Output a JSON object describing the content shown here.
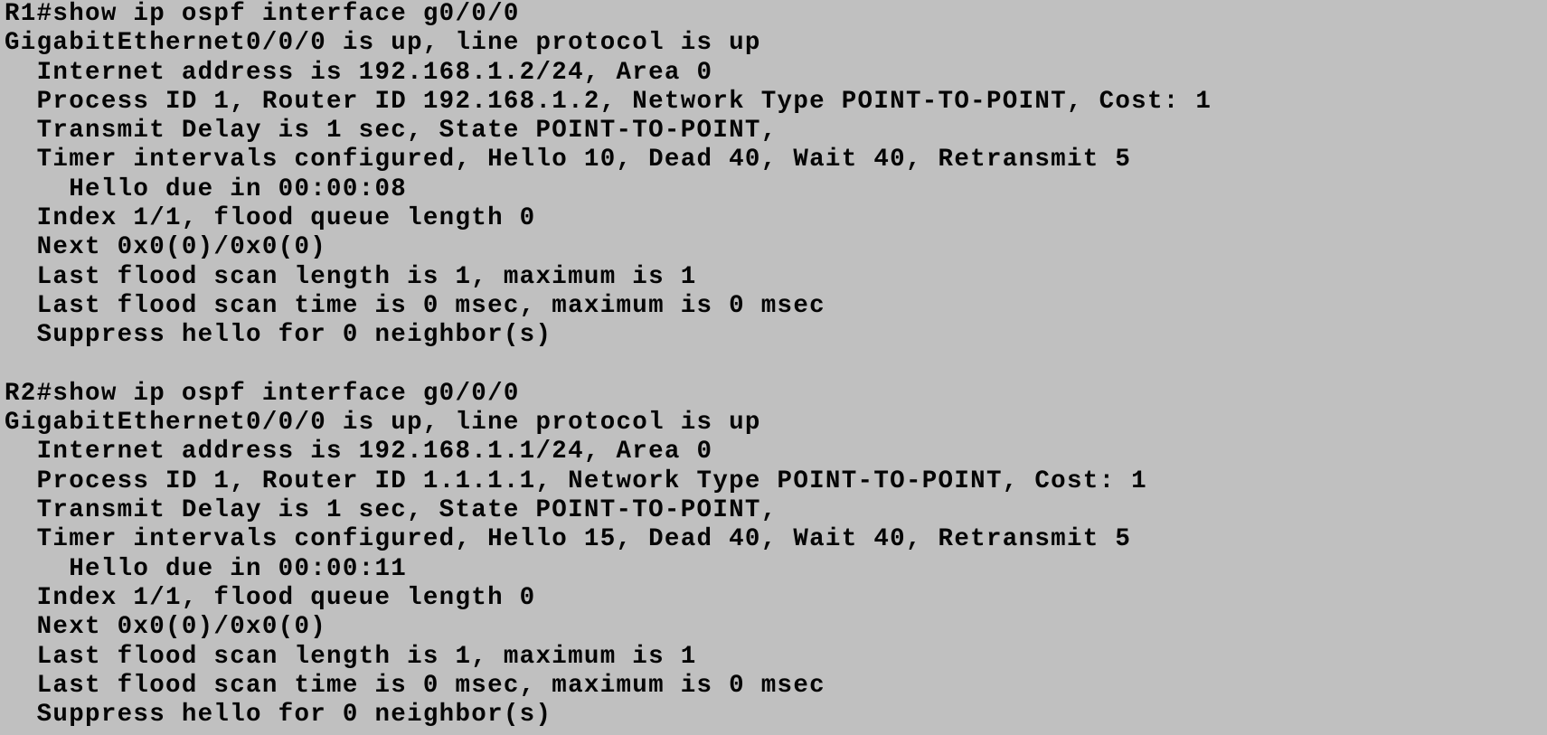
{
  "terminal": {
    "lines": [
      "R1#show ip ospf interface g0/0/0",
      "GigabitEthernet0/0/0 is up, line protocol is up",
      "  Internet address is 192.168.1.2/24, Area 0",
      "  Process ID 1, Router ID 192.168.1.2, Network Type POINT-TO-POINT, Cost: 1",
      "  Transmit Delay is 1 sec, State POINT-TO-POINT,",
      "  Timer intervals configured, Hello 10, Dead 40, Wait 40, Retransmit 5",
      "    Hello due in 00:00:08",
      "  Index 1/1, flood queue length 0",
      "  Next 0x0(0)/0x0(0)",
      "  Last flood scan length is 1, maximum is 1",
      "  Last flood scan time is 0 msec, maximum is 0 msec",
      "  Suppress hello for 0 neighbor(s)",
      "",
      "R2#show ip ospf interface g0/0/0",
      "GigabitEthernet0/0/0 is up, line protocol is up",
      "  Internet address is 192.168.1.1/24, Area 0",
      "  Process ID 1, Router ID 1.1.1.1, Network Type POINT-TO-POINT, Cost: 1",
      "  Transmit Delay is 1 sec, State POINT-TO-POINT,",
      "  Timer intervals configured, Hello 15, Dead 40, Wait 40, Retransmit 5",
      "    Hello due in 00:00:11",
      "  Index 1/1, flood queue length 0",
      "  Next 0x0(0)/0x0(0)",
      "  Last flood scan length is 1, maximum is 1",
      "  Last flood scan time is 0 msec, maximum is 0 msec",
      "  Suppress hello for 0 neighbor(s)"
    ]
  }
}
